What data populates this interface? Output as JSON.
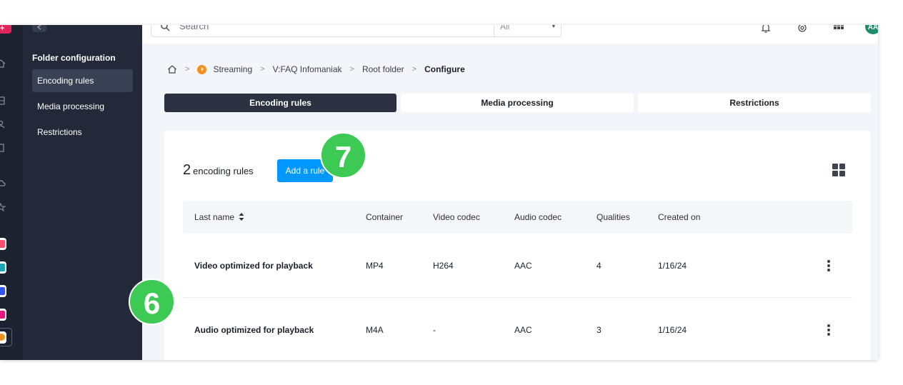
{
  "rail": {
    "top_badge_glyph": "+",
    "app_colors": [
      "#ff4d6d",
      "#1aa6b7",
      "#3156f5",
      "#e4197d",
      "#f78e1e"
    ]
  },
  "sidebar": {
    "section_title": "Folder configuration",
    "items": [
      {
        "label": "Encoding rules",
        "active": true
      },
      {
        "label": "Media processing",
        "active": false
      },
      {
        "label": "Restrictions",
        "active": false
      }
    ]
  },
  "header": {
    "search_placeholder": "Search",
    "search_scope": "All",
    "avatar_initials": "AA",
    "icons": [
      "bell-icon",
      "support-icon",
      "apps-grid-icon"
    ]
  },
  "breadcrumb": {
    "items": [
      "Streaming",
      "V:FAQ Infomaniak",
      "Root folder"
    ],
    "current": "Configure"
  },
  "tabs": [
    {
      "label": "Encoding rules",
      "active": true
    },
    {
      "label": "Media processing",
      "active": false
    },
    {
      "label": "Restrictions",
      "active": false
    }
  ],
  "rules": {
    "count": "2",
    "count_label": "encoding rules",
    "add_button": "Add a rule",
    "columns": [
      "Last name",
      "Container",
      "Video codec",
      "Audio codec",
      "Qualities",
      "Created on"
    ],
    "rows": [
      {
        "name": "Video optimized for playback",
        "container": "MP4",
        "video": "H264",
        "audio": "AAC",
        "qualities": "4",
        "created": "1/16/24"
      },
      {
        "name": "Audio optimized for playback",
        "container": "M4A",
        "video": "-",
        "audio": "AAC",
        "qualities": "3",
        "created": "1/16/24"
      }
    ]
  },
  "annotations": {
    "step_a": "7",
    "step_b": "6"
  },
  "colors": {
    "accent": "#0098ff",
    "step_badge": "#3cc954",
    "sidebar": "#232938",
    "rail": "#1d2230"
  }
}
